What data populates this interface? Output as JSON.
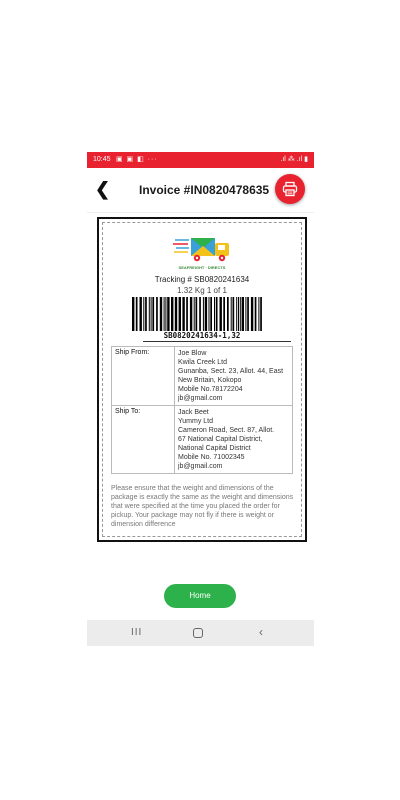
{
  "status_bar": {
    "time": "10:45",
    "left_icons": "▣ ▣ ◧  ···",
    "right_icons": ".ıl ⁂ .ıl ▮"
  },
  "app_bar": {
    "back_icon": "chevron-left-icon",
    "title": "Invoice #IN0820478635",
    "print_icon": "printer-icon"
  },
  "label": {
    "logo_text": "SEAFREIGHT · DIRECTS",
    "tracking": "Tracking # SB0820241634",
    "weight": "1.32 Kg 1 of 1",
    "barcode_text": "SB0820241634-1,32",
    "ship_from": {
      "label": "Ship From:",
      "lines": [
        "Joe Blow",
        "Kwila Creek Ltd",
        "Gunanba, Sect. 23, Allot. 44, East",
        "New Britain, Kokopo",
        "Mobile No.78172204",
        "jb@gmail.com"
      ]
    },
    "ship_to": {
      "label": "Ship To:",
      "lines": [
        "Jack Beet",
        "Yummy Ltd",
        "Cameron Road, Sect. 87, Allot.",
        "67 National Capital District,",
        "National Capital District",
        "Mobile No. 71002345",
        "jb@gmail.com"
      ]
    },
    "note": "Please ensure that the weight and dimensions of the package is exactly the same as the weight and dimensions that were specified at the time you placed the order for pickup. Your package may not fly if there is weight or dimension difference"
  },
  "home_button": {
    "label": "Home"
  },
  "nav_bar": {
    "recents_icon": "recents-icon",
    "home_icon": "home-icon",
    "back_icon": "back-icon",
    "recents_glyph": "III",
    "back_glyph": "‹"
  },
  "colors": {
    "accent_red": "#e8232f",
    "home_green": "#2db14a"
  }
}
